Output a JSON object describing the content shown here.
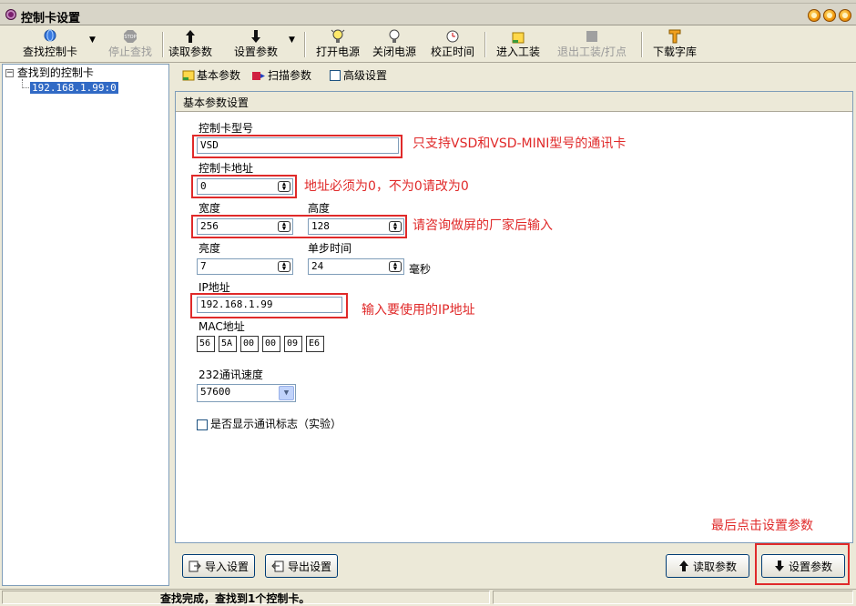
{
  "window": {
    "title": "控制卡设置"
  },
  "toolbar": {
    "search_card": "查找控制卡",
    "stop_search": "停止查找",
    "read_params": "读取参数",
    "set_params": "设置参数",
    "power_on": "打开电源",
    "power_off": "关闭电源",
    "calibrate_time": "校正时间",
    "enter_factory": "进入工装",
    "exit_factory": "退出工装/打点",
    "download_font": "下载字库"
  },
  "tree": {
    "root": "查找到的控制卡",
    "child": "192.168.1.99:0"
  },
  "tabs": {
    "basic": "基本参数",
    "scan": "扫描参数",
    "advanced": "高级设置"
  },
  "group": {
    "title": "基本参数设置",
    "card_model_label": "控制卡型号",
    "card_model_value": "VSD",
    "card_addr_label": "控制卡地址",
    "card_addr_value": "0",
    "width_label": "宽度",
    "width_value": "256",
    "height_label": "高度",
    "height_value": "128",
    "brightness_label": "亮度",
    "brightness_value": "7",
    "step_label": "单步时间",
    "step_value": "24",
    "step_unit": "毫秒",
    "ip_label": "IP地址",
    "ip_value": "192.168.1.99",
    "mac_label": "MAC地址",
    "mac": [
      "56",
      "5A",
      "00",
      "00",
      "09",
      "E6"
    ],
    "baud_label": "232通讯速度",
    "baud_value": "57600",
    "show_log_label": "是否显示通讯标志（实验）"
  },
  "annotations": {
    "model": "只支持VSD和VSD-MINI型号的通讯卡",
    "addr": "地址必须为0，不为0请改为0",
    "size": "请咨询做屏的厂家后输入",
    "ip": "输入要使用的IP地址",
    "final": "最后点击设置参数"
  },
  "buttons": {
    "import": "导入设置",
    "export": "导出设置",
    "read": "读取参数",
    "set": "设置参数"
  },
  "status": {
    "text": "查找完成，查找到1个控制卡。"
  },
  "colors": {
    "annotation_red": "#e02a2a",
    "selection_blue": "#316ac5"
  }
}
